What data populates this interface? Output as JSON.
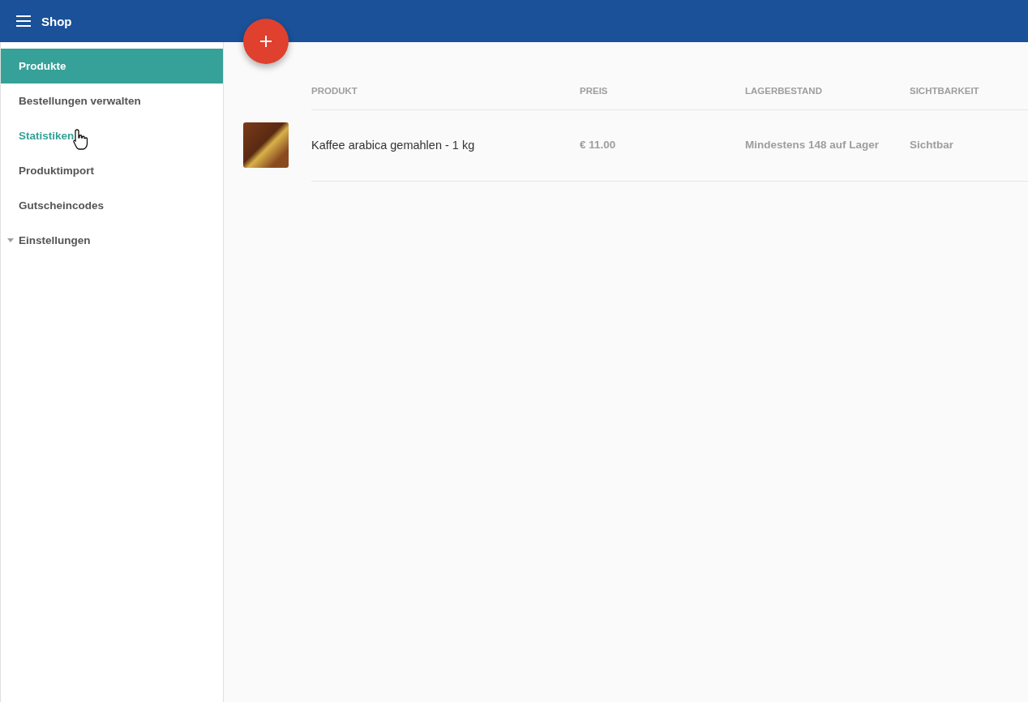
{
  "app_bar": {
    "title": "Shop"
  },
  "sidebar": {
    "items": [
      {
        "label": "Produkte",
        "kind": "item",
        "selected": true,
        "hovered": false
      },
      {
        "label": "Bestellungen verwalten",
        "kind": "item",
        "selected": false,
        "hovered": false
      },
      {
        "label": "Statistiken",
        "kind": "item",
        "selected": false,
        "hovered": true
      },
      {
        "label": "Produktimport",
        "kind": "item",
        "selected": false,
        "hovered": false
      },
      {
        "label": "Gutscheincodes",
        "kind": "item",
        "selected": false,
        "hovered": false
      },
      {
        "label": "Einstellungen",
        "kind": "group",
        "selected": false,
        "hovered": false
      }
    ]
  },
  "table": {
    "columns": [
      "PRODUKT",
      "PREIS",
      "LAGERBESTAND",
      "SICHTBARKEIT"
    ],
    "rows": [
      {
        "product": "Kaffee arabica gemahlen - 1 kg",
        "price": "€ 11.00",
        "stock": "Mindestens 148 auf Lager",
        "visibility": "Sichtbar"
      }
    ]
  }
}
